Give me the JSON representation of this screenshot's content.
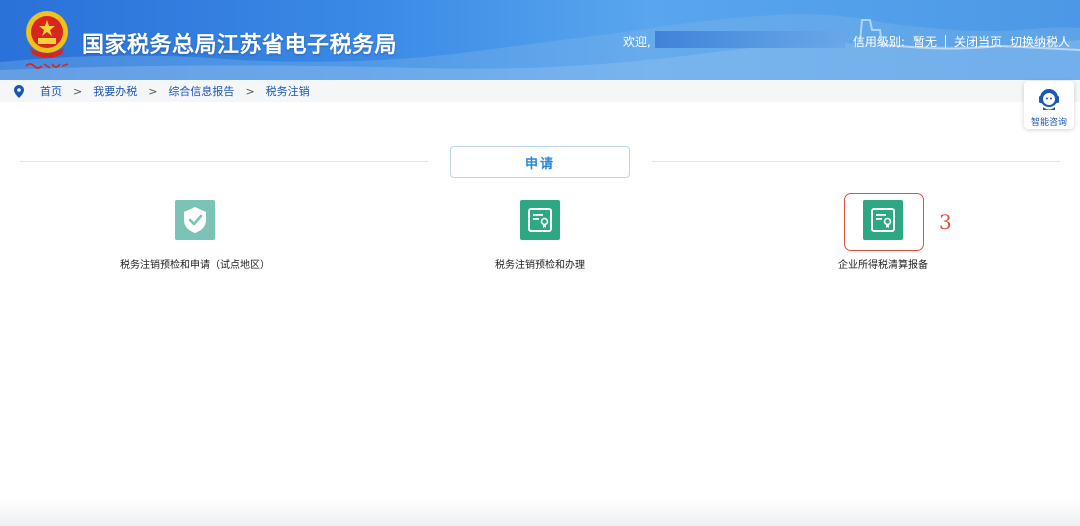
{
  "header": {
    "site_title": "国家税务总局江苏省电子税务局",
    "welcome": "欢迎,",
    "credit_level_label": "信用级别:",
    "credit_level_value": "暂无",
    "close_page": "关闭当页",
    "switch_taxpayer": "切换纳税人"
  },
  "breadcrumb": {
    "items": [
      "首页",
      "我要办税",
      "综合信息报告",
      "税务注销"
    ],
    "separator": ">"
  },
  "consult": {
    "label": "智能咨询"
  },
  "section": {
    "title": "申请"
  },
  "services": [
    {
      "label": "税务注销预检和申请（试点地区）",
      "icon": "shield-check-icon"
    },
    {
      "label": "税务注销预检和办理",
      "icon": "certificate-icon"
    },
    {
      "label": "企业所得税清算报备",
      "icon": "certificate-icon"
    }
  ],
  "annotation": {
    "step": "3"
  },
  "colors": {
    "header_blue": "#3b8ae6",
    "link_blue": "#1a56b8",
    "section_blue": "#2a86d6",
    "icon_teal_light": "#7cc3b7",
    "icon_teal": "#2ea884",
    "annotation_red": "#e0503a"
  }
}
